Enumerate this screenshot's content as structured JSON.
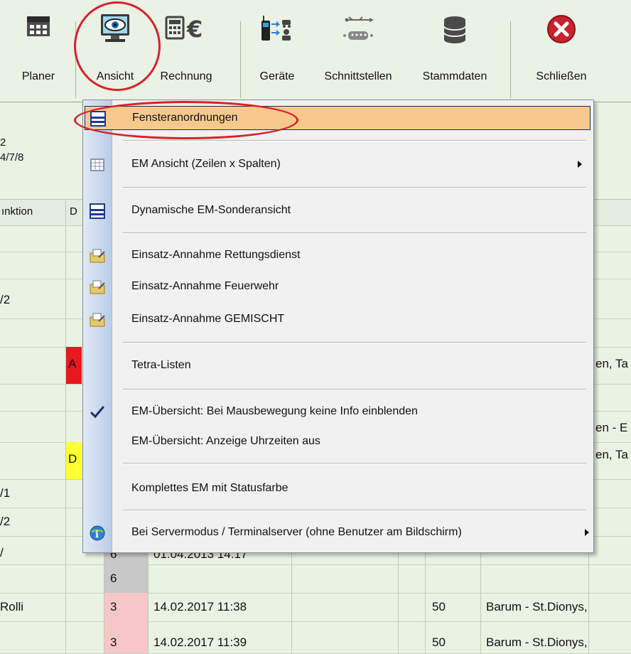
{
  "toolbar": {
    "buttons": [
      {
        "label": "Planer",
        "icon": "calendar-grid-icon"
      },
      {
        "label": "Ansicht",
        "icon": "monitor-eye-icon"
      },
      {
        "label": "Rechnung",
        "icon": "calculator-euro-icon"
      },
      {
        "label": "Geräte",
        "icon": "radio-devices-icon"
      },
      {
        "label": "Schnittstellen",
        "icon": "usb-serial-icon"
      },
      {
        "label": "Stammdaten",
        "icon": "database-icon"
      },
      {
        "label": "Schließen",
        "icon": "close-circle-icon"
      }
    ]
  },
  "info": {
    "line1": "2",
    "line2": "4/7/8"
  },
  "grid": {
    "header_fragment_1": "ınktion",
    "header_fragment_2": "D",
    "left_fragments": [
      "/2",
      "/1",
      "/2",
      "/",
      "Rolli"
    ],
    "red_badge": "A",
    "yellow_badge": "D",
    "right_fragments": [
      "en, Ta",
      "en - E",
      "en, Ta"
    ],
    "rows": [
      {
        "status": "6",
        "date": "01.04.2013 14.17",
        "num": "",
        "place": ""
      },
      {
        "status": "6",
        "date": "",
        "num": "",
        "place": ""
      },
      {
        "status": "3",
        "date": "14.02.2017 11:38",
        "num": "50",
        "place": "Barum - St.Dionys,"
      },
      {
        "status": "3",
        "date": "14.02.2017 11:39",
        "num": "50",
        "place": "Barum - St.Dionys,"
      }
    ]
  },
  "menu": {
    "items": [
      {
        "label": "Fensteranordnungen",
        "icon": "window-layout-icon",
        "highlighted": true
      },
      {
        "label": "EM Ansicht (Zeilen x Spalten)",
        "icon": "table-view-icon",
        "submenu": true
      },
      {
        "label": "Dynamische EM-Sonderansicht",
        "icon": "window-layout-icon"
      },
      {
        "label": "Einsatz-Annahme Rettungsdienst",
        "icon": "folder-edit-icon"
      },
      {
        "label": "Einsatz-Annahme Feuerwehr",
        "icon": "folder-edit-icon"
      },
      {
        "label": "Einsatz-Annahme GEMISCHT",
        "icon": "folder-edit-icon"
      },
      {
        "label": "Tetra-Listen",
        "icon": ""
      },
      {
        "label": "EM-Übersicht: Bei Mausbewegung keine Info einblenden",
        "icon": "checkmark-icon",
        "checked": true
      },
      {
        "label": "EM-Übersicht: Anzeige Uhrzeiten aus",
        "icon": ""
      },
      {
        "label": "Komplettes EM mit Statusfarbe",
        "icon": ""
      },
      {
        "label": "Bei Servermodus / Terminalserver (ohne Benutzer am Bildschirm)",
        "icon": "info-globe-icon",
        "submenu": true
      }
    ]
  },
  "colors": {
    "accent_red": "#d8222a",
    "highlight": "#f7c98d",
    "status_pink": "#f7c7c7",
    "status_gray": "#c8c8c8"
  }
}
